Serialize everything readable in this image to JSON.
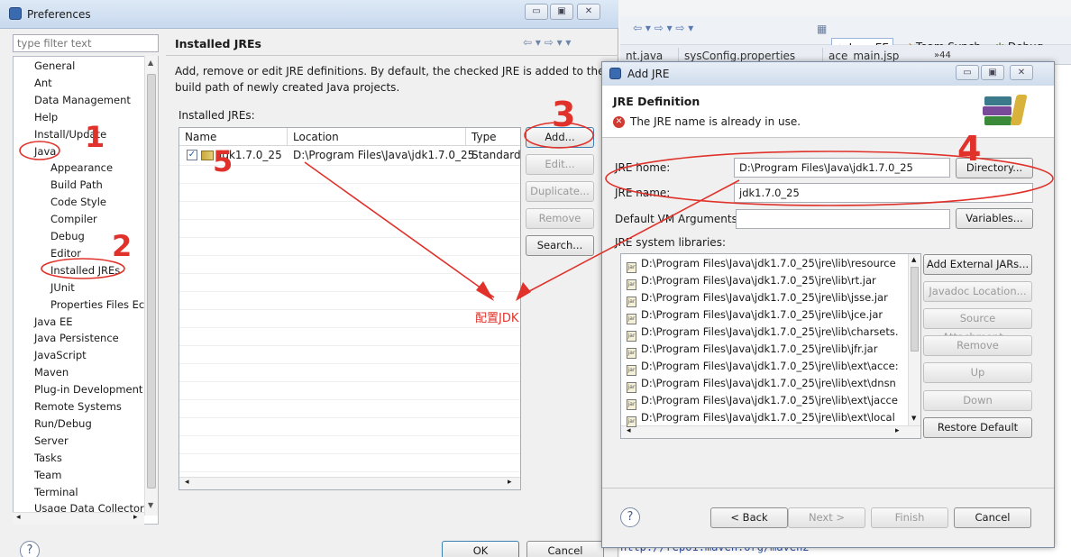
{
  "background": {
    "perspectives": [
      "Java EE",
      "Team Synch...",
      "Debug"
    ],
    "tabs": [
      "nt.java",
      "sysConfig.properties",
      "ace_main.jsp",
      "»44"
    ],
    "url_fragment": "http://repo1.maven.org/maven2"
  },
  "preferences": {
    "title": "Preferences",
    "filter_placeholder": "type filter text",
    "tree": [
      "General",
      "Ant",
      "Data Management",
      "Help",
      "Install/Update",
      "Java",
      "Appearance",
      "Build Path",
      "Code Style",
      "Compiler",
      "Debug",
      "Editor",
      "Installed JREs",
      "JUnit",
      "Properties Files Ec",
      "Java EE",
      "Java Persistence",
      "JavaScript",
      "Maven",
      "Plug-in Development",
      "Remote Systems",
      "Run/Debug",
      "Server",
      "Tasks",
      "Team",
      "Terminal",
      "Usage Data Collector"
    ],
    "page_title": "Installed JREs",
    "description": "Add, remove or edit JRE definitions. By default, the checked JRE is added to the build path of newly created Java projects.",
    "table_label": "Installed JREs:",
    "columns": [
      "Name",
      "Location",
      "Type"
    ],
    "row": {
      "name": "jdk1.7.0_25",
      "location": "D:\\Program Files\\Java\\jdk1.7.0_25",
      "type": "Standard"
    },
    "buttons": {
      "add": "Add...",
      "edit": "Edit...",
      "duplicate": "Duplicate...",
      "remove": "Remove",
      "search": "Search..."
    },
    "ok": "OK",
    "cancel": "Cancel"
  },
  "dialog": {
    "title": "Add JRE",
    "heading": "JRE Definition",
    "error": "The JRE name is already in use.",
    "jre_home_label": "JRE home:",
    "jre_home_value": "D:\\Program Files\\Java\\jdk1.7.0_25",
    "directory_button": "Directory...",
    "jre_name_label": "JRE name:",
    "jre_name_value": "jdk1.7.0_25",
    "vm_args_label": "Default VM Arguments:",
    "vm_args_value": "",
    "variables_button": "Variables...",
    "libs_label": "JRE system libraries:",
    "libs": [
      "D:\\Program Files\\Java\\jdk1.7.0_25\\jre\\lib\\resource",
      "D:\\Program Files\\Java\\jdk1.7.0_25\\jre\\lib\\rt.jar",
      "D:\\Program Files\\Java\\jdk1.7.0_25\\jre\\lib\\jsse.jar",
      "D:\\Program Files\\Java\\jdk1.7.0_25\\jre\\lib\\jce.jar",
      "D:\\Program Files\\Java\\jdk1.7.0_25\\jre\\lib\\charsets.",
      "D:\\Program Files\\Java\\jdk1.7.0_25\\jre\\lib\\jfr.jar",
      "D:\\Program Files\\Java\\jdk1.7.0_25\\jre\\lib\\ext\\acce:",
      "D:\\Program Files\\Java\\jdk1.7.0_25\\jre\\lib\\ext\\dnsn",
      "D:\\Program Files\\Java\\jdk1.7.0_25\\jre\\lib\\ext\\jacce",
      "D:\\Program Files\\Java\\jdk1.7.0_25\\jre\\lib\\ext\\local"
    ],
    "lib_buttons": [
      "Add External JARs...",
      "Javadoc Location...",
      "Source Attachment...",
      "Remove",
      "Up",
      "Down",
      "Restore Default"
    ],
    "back": "< Back",
    "next": "Next >",
    "finish": "Finish",
    "cancel": "Cancel"
  },
  "annotations": {
    "numbers": [
      "1",
      "2",
      "3",
      "4",
      "5"
    ],
    "note": "配置JDK",
    "color": "#e0322b"
  }
}
